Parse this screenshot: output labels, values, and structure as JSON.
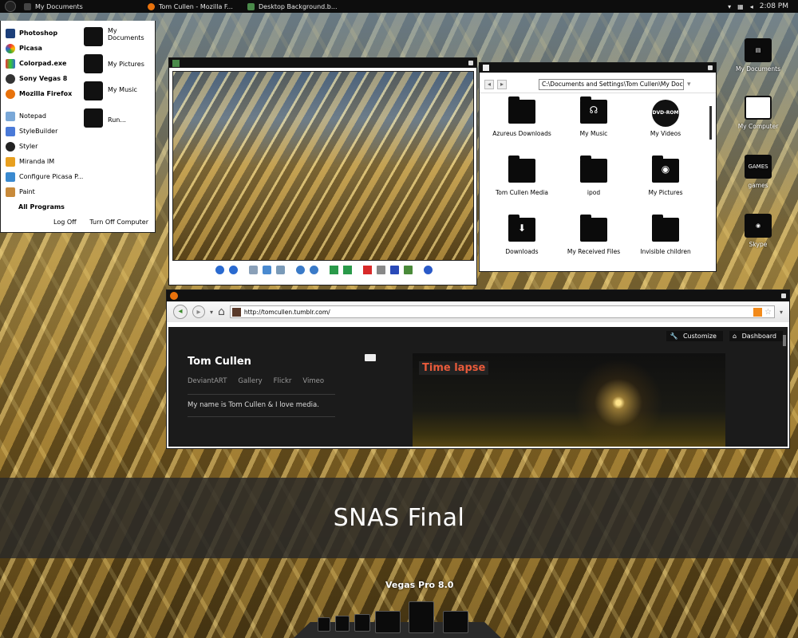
{
  "taskbar": {
    "tasks": [
      {
        "label": "My Documents",
        "color": "#444"
      },
      {
        "label": "Tom Cullen - Mozilla F...",
        "color": "#e8720c"
      },
      {
        "label": "Desktop Background.b...",
        "color": "#4a8a4a"
      }
    ],
    "clock": "2:08 PM"
  },
  "start_menu": {
    "pinned": [
      "Photoshop",
      "Picasa",
      "Colorpad.exe",
      "Sony Vegas 8",
      "Mozilla Firefox"
    ],
    "recent": [
      "Notepad",
      "StyleBuilder",
      "Styler",
      "Miranda IM",
      "Configure Picasa P...",
      "Paint"
    ],
    "places": [
      "My Documents",
      "My Pictures",
      "My Music",
      "Run..."
    ],
    "all_programs": "All Programs",
    "log_off": "Log Off",
    "turn_off": "Turn Off Computer"
  },
  "explorer": {
    "address": "C:\\Documents and Settings\\Tom Cullen\\My Docu",
    "items": [
      "Azureus Downloads",
      "My Music",
      "My Videos",
      "Tom Cullen Media",
      "ipod",
      "My Pictures",
      "Downloads",
      "My Received Files",
      "Invisible children"
    ],
    "dvd_label": "DVD-ROM"
  },
  "browser": {
    "url": "http://tomcullen.tumblr.com/",
    "customize": "Customize",
    "dashboard": "Dashboard",
    "blog_title": "Tom Cullen",
    "links": [
      "DeviantART",
      "Gallery",
      "Flickr",
      "Vimeo"
    ],
    "description": "My name is Tom Cullen & I love media.",
    "post_title": "Time lapse"
  },
  "desktop_icons": [
    "My Documents",
    "My Computer",
    "games",
    "Skype"
  ],
  "games_icon_text": "GAMES",
  "banner": "SNAS Final",
  "dock_label": "Vegas Pro 8.0"
}
